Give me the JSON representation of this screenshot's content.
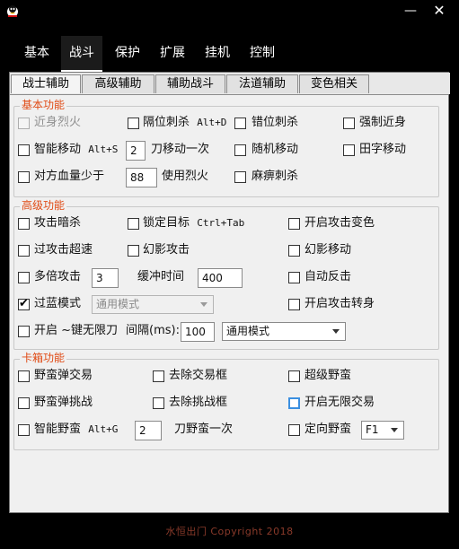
{
  "window": {
    "minimize_glyph": "—",
    "close_glyph": "✕"
  },
  "menu": [
    "基本",
    "战斗",
    "保护",
    "扩展",
    "挂机",
    "控制"
  ],
  "subtabs": [
    "战士辅助",
    "高级辅助",
    "辅助战斗",
    "法道辅助",
    "变色相关"
  ],
  "groups": {
    "basic": {
      "title": "基本功能",
      "jinshen": "近身烈火",
      "geweicisha": "隔位刺杀",
      "geweicisha_hotkey": "Alt+D",
      "cuoweicisha": "错位刺杀",
      "qiangzhijinshen": "强制近身",
      "zhinengyidong": "智能移动",
      "zhinengyidong_hotkey": "Alt+S",
      "dao_value": "2",
      "dao_label": "刀移动一次",
      "suijiyidong": "随机移动",
      "tianziyidong": "田字移动",
      "duifangxue": "对方血量少于",
      "xue_value": "88",
      "shiyonglieho": "使用烈火",
      "mabicisha": "麻痹刺杀"
    },
    "advanced": {
      "title": "高级功能",
      "gongjianshasha": "攻击暗杀",
      "suodingmubiao": "锁定目标",
      "suodingmubiao_hotkey": "Ctrl+Tab",
      "kaiqibianse": "开启攻击变色",
      "guogongjichaosu": "过攻击超速",
      "huanyinggongji": "幻影攻击",
      "huanyingyidong": "幻影移动",
      "duobeigongji": "多倍攻击",
      "duobei_value": "3",
      "huanchong_label": "缓冲时间",
      "huanchong_value": "400",
      "zidongfanji": "自动反击",
      "guolanmoshi": "过蓝模式",
      "guolan_select": "通用模式",
      "kaiqizhuanshen": "开启攻击转身",
      "wuxiandao": "开启 ~键无限刀",
      "interval_label": "间隔(ms):",
      "interval_value": "100",
      "wuxian_select": "通用模式"
    },
    "card": {
      "title": "卡箱功能",
      "yemanjiaoyi": "野蛮弹交易",
      "quchujiaoyi": "去除交易框",
      "chaojiyeman": "超级野蛮",
      "yemantiaozhan": "野蛮弹挑战",
      "quchutiaozhan": "去除挑战框",
      "wuxianjiaoyi": "开启无限交易",
      "zhinengyeman": "智能野蛮",
      "zhinengyeman_hotkey": "Alt+G",
      "dao_value": "2",
      "dao_label": "刀野蛮一次",
      "dingxiangyeman": "定向野蛮",
      "fkey_select": "F1"
    }
  },
  "footer": "水恒出门   Copyright 2018",
  "colors": {
    "group_title": "#e04a14",
    "background": "#000000",
    "panel": "#f0f0f0"
  }
}
